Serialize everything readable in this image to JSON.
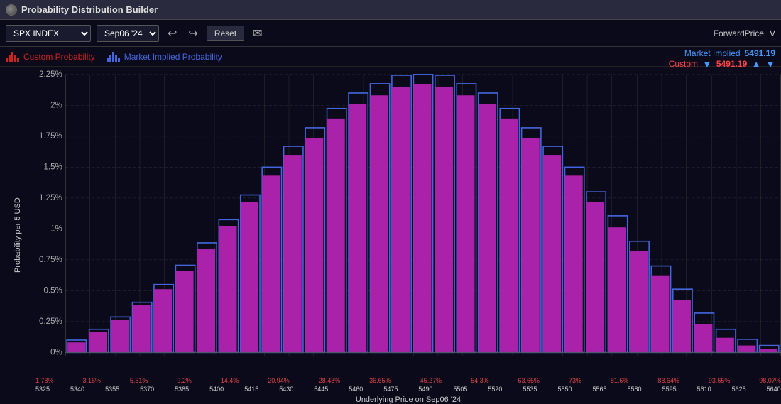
{
  "titleBar": {
    "title": "Probability Distribution Builder"
  },
  "toolbar": {
    "instrument": "SPX INDEX",
    "expiry": "Sep06 '24",
    "resetLabel": "Reset",
    "forwardPriceLabel": "ForwardPrice",
    "vLabel": "V"
  },
  "legend": {
    "customLabel": "Custom Probability",
    "marketLabel": "Market Implied Probability",
    "marketImpliedLabel": "Market Implied",
    "customShortLabel": "Custom",
    "marketImpliedValue": "5491.19",
    "customValue": "5491.19"
  },
  "chart": {
    "yAxisLabel": "Probability per 5 USD",
    "xAxisTitle": "Underlying Price on Sep06 '24",
    "yTicks": [
      "2.25%",
      "2%",
      "1.75%",
      "1.5%",
      "1.25%",
      "1%",
      "0.75%",
      "0.5%",
      "0.25%",
      "0%"
    ],
    "xPercents": [
      "1.78%",
      "3.16%",
      "5.51%",
      "9.2%",
      "14.4%",
      "20.94%",
      "28.48%",
      "36.65%",
      "45.27%",
      "54.3%",
      "63.66%",
      "73%",
      "81.6%",
      "88.64%",
      "93.65%",
      "98.07%"
    ],
    "xPrices": [
      "5325",
      "5340",
      "5355",
      "5370",
      "5385",
      "5400",
      "5415",
      "5430",
      "5445",
      "5460",
      "5475",
      "5490",
      "5505",
      "5520",
      "5535",
      "5550",
      "5565",
      "5580",
      "5595",
      "5610",
      "5625",
      "5640"
    ],
    "bars": [
      {
        "x": 0.01,
        "custom": 0.11,
        "market": 0.12
      },
      {
        "x": 0.04,
        "custom": 0.18,
        "market": 0.2
      },
      {
        "x": 0.07,
        "custom": 0.28,
        "market": 0.3
      },
      {
        "x": 0.1,
        "custom": 0.4,
        "market": 0.43
      },
      {
        "x": 0.13,
        "custom": 0.55,
        "market": 0.58
      },
      {
        "x": 0.16,
        "custom": 0.7,
        "market": 0.74
      },
      {
        "x": 0.19,
        "custom": 0.88,
        "market": 0.93
      },
      {
        "x": 0.22,
        "custom": 1.08,
        "market": 1.13
      },
      {
        "x": 0.25,
        "custom": 1.28,
        "market": 1.34
      },
      {
        "x": 0.28,
        "custom": 1.5,
        "market": 1.57
      },
      {
        "x": 0.31,
        "custom": 1.68,
        "market": 1.76
      },
      {
        "x": 0.34,
        "custom": 1.85,
        "market": 1.94
      },
      {
        "x": 0.37,
        "custom": 2.0,
        "market": 2.1
      },
      {
        "x": 0.4,
        "custom": 2.12,
        "market": 2.22
      },
      {
        "x": 0.43,
        "custom": 2.2,
        "market": 2.28
      },
      {
        "x": 0.46,
        "custom": 2.28,
        "market": 2.35
      },
      {
        "x": 0.49,
        "custom": 2.3,
        "market": 2.36
      },
      {
        "x": 0.52,
        "custom": 2.28,
        "market": 2.35
      },
      {
        "x": 0.55,
        "custom": 2.22,
        "market": 2.28
      },
      {
        "x": 0.58,
        "custom": 2.12,
        "market": 2.18
      },
      {
        "x": 0.61,
        "custom": 2.0,
        "market": 2.06
      },
      {
        "x": 0.64,
        "custom": 1.85,
        "market": 1.92
      },
      {
        "x": 0.67,
        "custom": 1.68,
        "market": 1.75
      },
      {
        "x": 0.7,
        "custom": 1.5,
        "market": 1.58
      },
      {
        "x": 0.73,
        "custom": 1.3,
        "market": 1.38
      },
      {
        "x": 0.76,
        "custom": 1.1,
        "market": 1.18
      },
      {
        "x": 0.79,
        "custom": 0.9,
        "market": 0.98
      },
      {
        "x": 0.82,
        "custom": 0.7,
        "market": 0.78
      },
      {
        "x": 0.85,
        "custom": 0.5,
        "market": 0.58
      },
      {
        "x": 0.88,
        "custom": 0.33,
        "market": 0.4
      },
      {
        "x": 0.91,
        "custom": 0.2,
        "market": 0.26
      },
      {
        "x": 0.94,
        "custom": 0.1,
        "market": 0.14
      },
      {
        "x": 0.97,
        "custom": 0.04,
        "market": 0.06
      }
    ]
  }
}
